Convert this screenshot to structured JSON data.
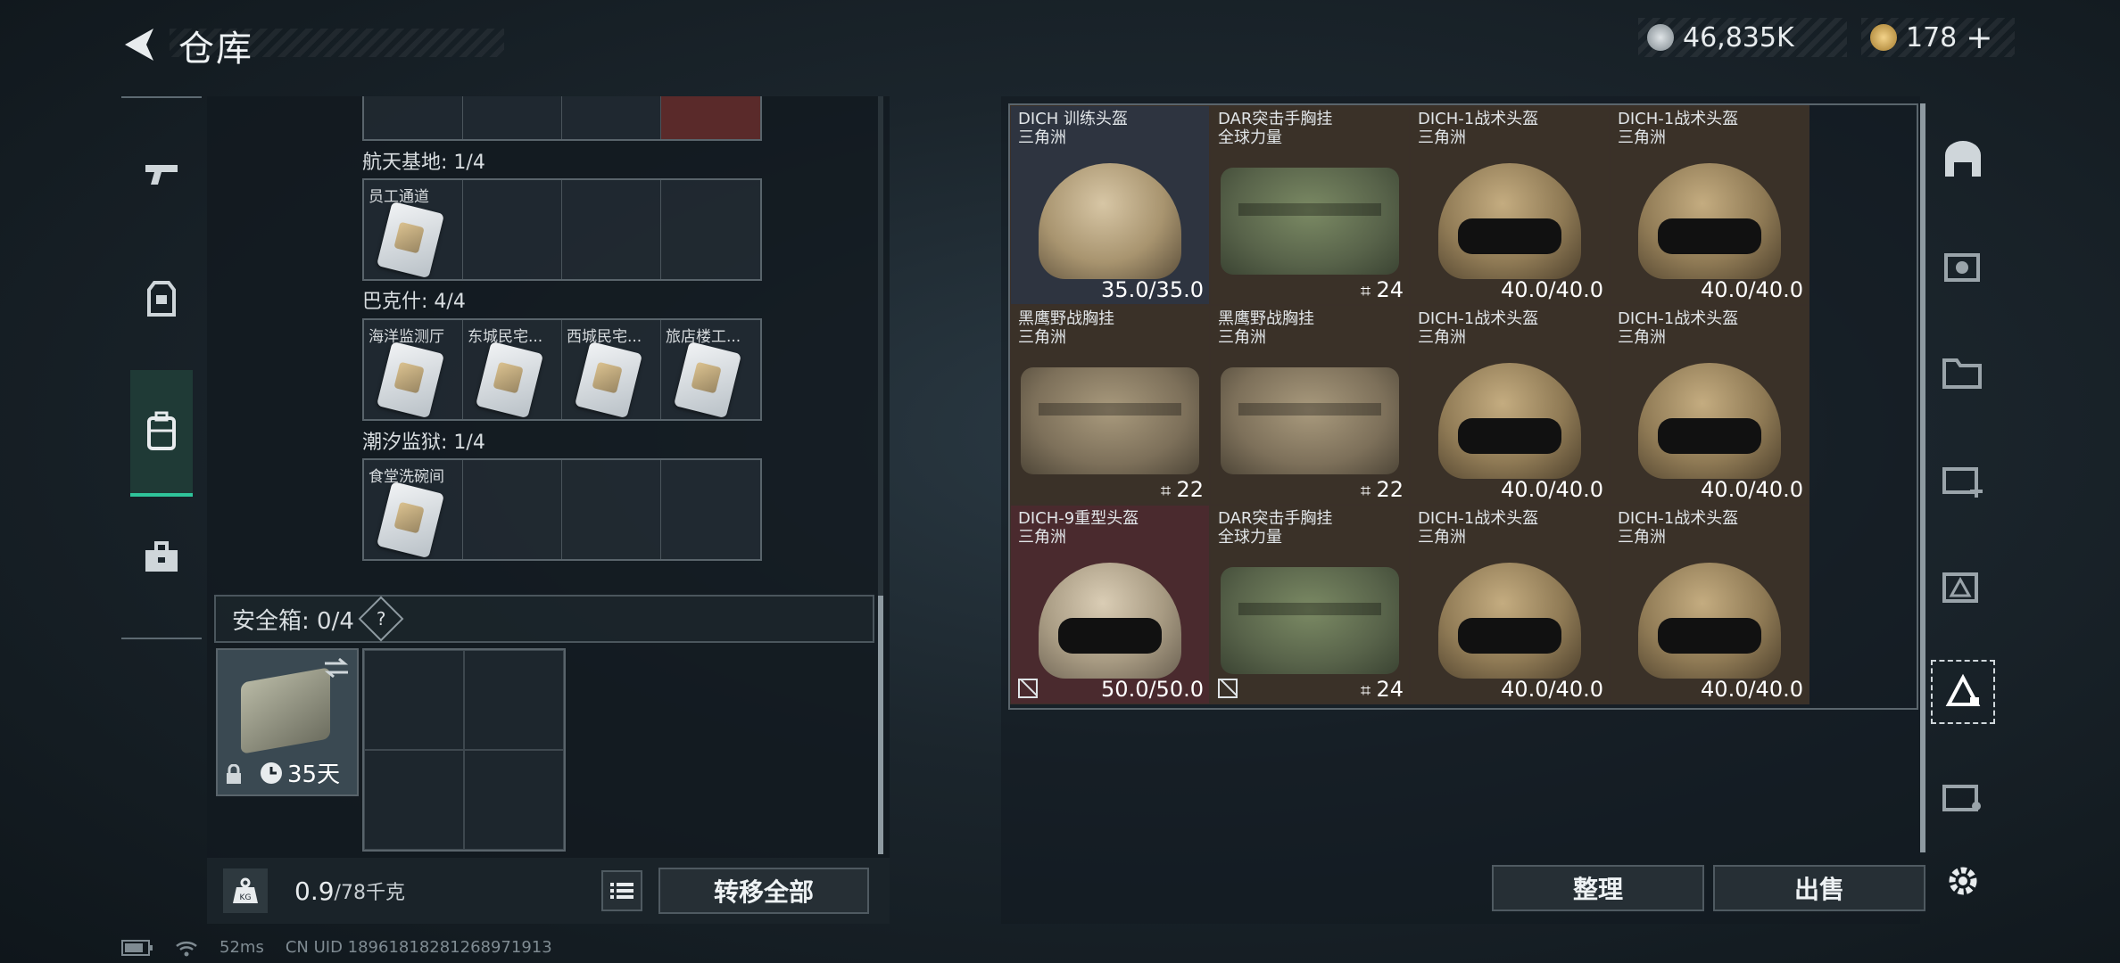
{
  "header": {
    "title": "仓库",
    "currency_silver": "46,835K",
    "currency_gold": "178",
    "add_symbol": "+"
  },
  "nav": {
    "items": [
      {
        "name": "weapons"
      },
      {
        "name": "equipment"
      },
      {
        "name": "containers",
        "active": true
      },
      {
        "name": "toolbox"
      }
    ]
  },
  "keys_section": {
    "groups": [
      {
        "label": "航天基地: 1/4",
        "cells": [
          "员工通道",
          "",
          "",
          ""
        ]
      },
      {
        "label": "巴克什: 4/4",
        "cells": [
          "海洋监测厅",
          "东城民宅...",
          "西城民宅...",
          "旅店楼工..."
        ]
      },
      {
        "label": "潮汐监狱: 1/4",
        "cells": [
          "食堂洗碗间",
          "",
          "",
          ""
        ]
      }
    ]
  },
  "safe_box": {
    "label": "安全箱: 0/4",
    "help": "?",
    "duration": "35天"
  },
  "weight": {
    "current": "0.9",
    "max": "/78千克",
    "icon_text": "KG"
  },
  "buttons": {
    "transfer_all": "转移全部",
    "organize": "整理",
    "sell": "出售"
  },
  "items": [
    {
      "name": "DICH 训练头盔",
      "sub": "三角洲",
      "value": "35.0/35.0",
      "kind": "helmet-train",
      "bg": "#2e3440"
    },
    {
      "name": "DAR突击手胸挂",
      "sub": "全球力量",
      "value": "24",
      "kind": "rig-green",
      "bg": "#3a3128",
      "cap": true
    },
    {
      "name": "DICH-1战术头盔",
      "sub": "三角洲",
      "value": "40.0/40.0",
      "kind": "helmet",
      "bg": "#3a3128"
    },
    {
      "name": "DICH-1战术头盔",
      "sub": "三角洲",
      "value": "40.0/40.0",
      "kind": "helmet",
      "bg": "#3a3128"
    },
    {
      "name": "黑鹰野战胸挂",
      "sub": "三角洲",
      "value": "22",
      "kind": "rig-tan",
      "bg": "#3a3128",
      "cap": true
    },
    {
      "name": "黑鹰野战胸挂",
      "sub": "三角洲",
      "value": "22",
      "kind": "rig-tan",
      "bg": "#3a3128",
      "cap": true
    },
    {
      "name": "DICH-1战术头盔",
      "sub": "三角洲",
      "value": "40.0/40.0",
      "kind": "helmet",
      "bg": "#3a3128"
    },
    {
      "name": "DICH-1战术头盔",
      "sub": "三角洲",
      "value": "40.0/40.0",
      "kind": "helmet",
      "bg": "#3a3128"
    },
    {
      "name": "DICH-9重型头盔",
      "sub": "三角洲",
      "value": "50.0/50.0",
      "kind": "helmet-heavy",
      "bg": "#4a2a2e",
      "nomark": true
    },
    {
      "name": "DAR突击手胸挂",
      "sub": "全球力量",
      "value": "24",
      "kind": "rig-green",
      "bg": "#3a3128",
      "cap": true,
      "nomark": true
    },
    {
      "name": "DICH-1战术头盔",
      "sub": "三角洲",
      "value": "40.0/40.0",
      "kind": "helmet",
      "bg": "#3a3128"
    },
    {
      "name": "DICH-1战术头盔",
      "sub": "三角洲",
      "value": "40.0/40.0",
      "kind": "helmet",
      "bg": "#3a3128"
    }
  ],
  "footer": {
    "ping": "52ms",
    "uid": "CN UID 18961818281268971913"
  }
}
